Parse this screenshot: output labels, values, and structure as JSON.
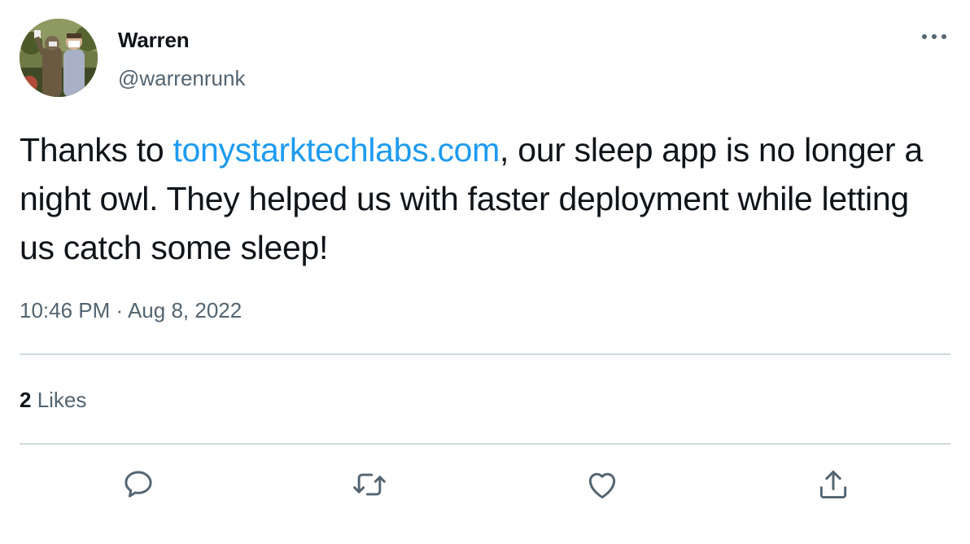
{
  "author": {
    "display_name": "Warren",
    "handle": "@warrenrunk",
    "avatar_icon": "profile-photo"
  },
  "tweet": {
    "text_before_link": "Thanks to ",
    "link_text": "tonystarktechlabs.com",
    "text_after_link": ", our sleep app is no longer a night owl. They helped us with faster deployment while letting us catch some sleep!",
    "time": "10:46 PM",
    "separator": " · ",
    "date": "Aug 8, 2022"
  },
  "stats": {
    "likes_count": "2",
    "likes_label": " Likes"
  },
  "actions": [
    {
      "icon": "reply-icon"
    },
    {
      "icon": "retweet-icon"
    },
    {
      "icon": "like-icon"
    },
    {
      "icon": "share-icon"
    }
  ],
  "colors": {
    "link": "#1d9bf0",
    "secondary_text": "#536471",
    "primary_text": "#0f1419",
    "divider": "#cfd9de"
  }
}
